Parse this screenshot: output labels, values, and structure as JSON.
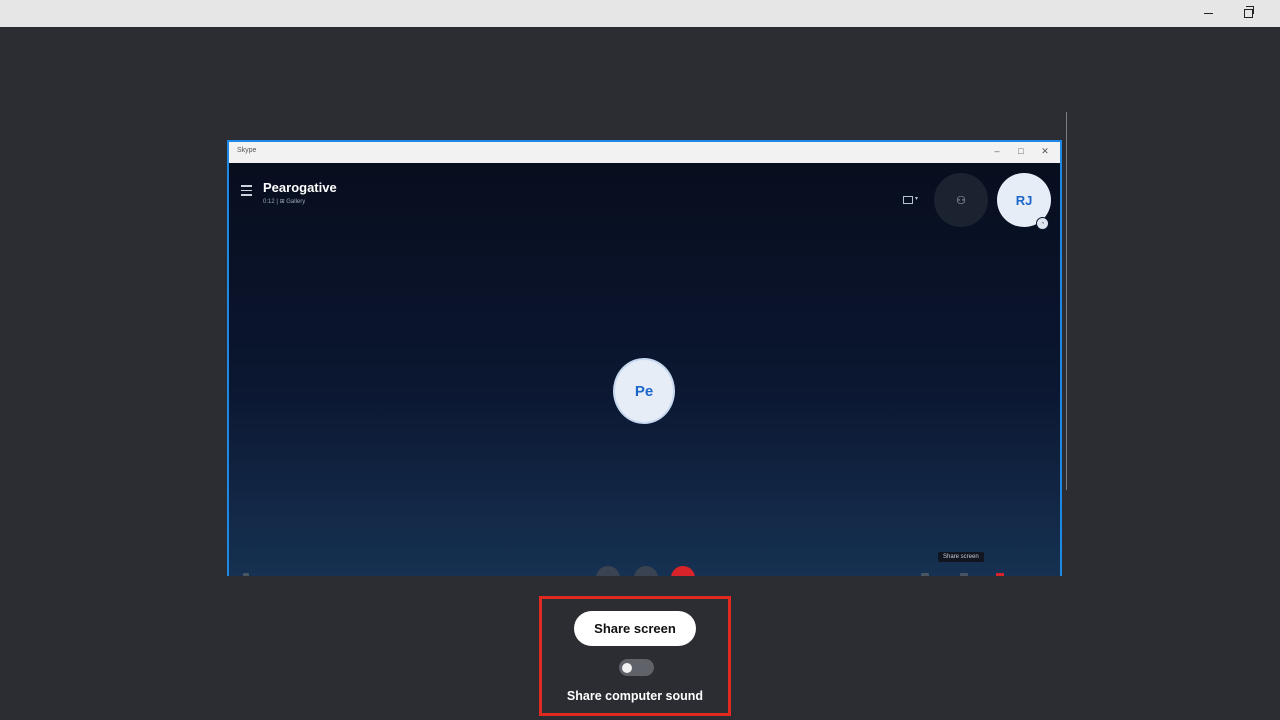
{
  "preview": {
    "app_name": "Skype",
    "call_title": "Pearogative",
    "call_subtitle": "0:12  |  ⊞ Gallery",
    "avatar_rj": "RJ",
    "avatar_pe": "Pe",
    "tooltip": "Share screen",
    "colors": {
      "border": "#1e88e5",
      "end_call": "#d8232a",
      "avatar_text": "#1b66c9"
    }
  },
  "share_panel": {
    "share_button": "Share screen",
    "sound_label": "Share computer sound",
    "sound_enabled": false,
    "highlight_color": "#e02a1f"
  }
}
